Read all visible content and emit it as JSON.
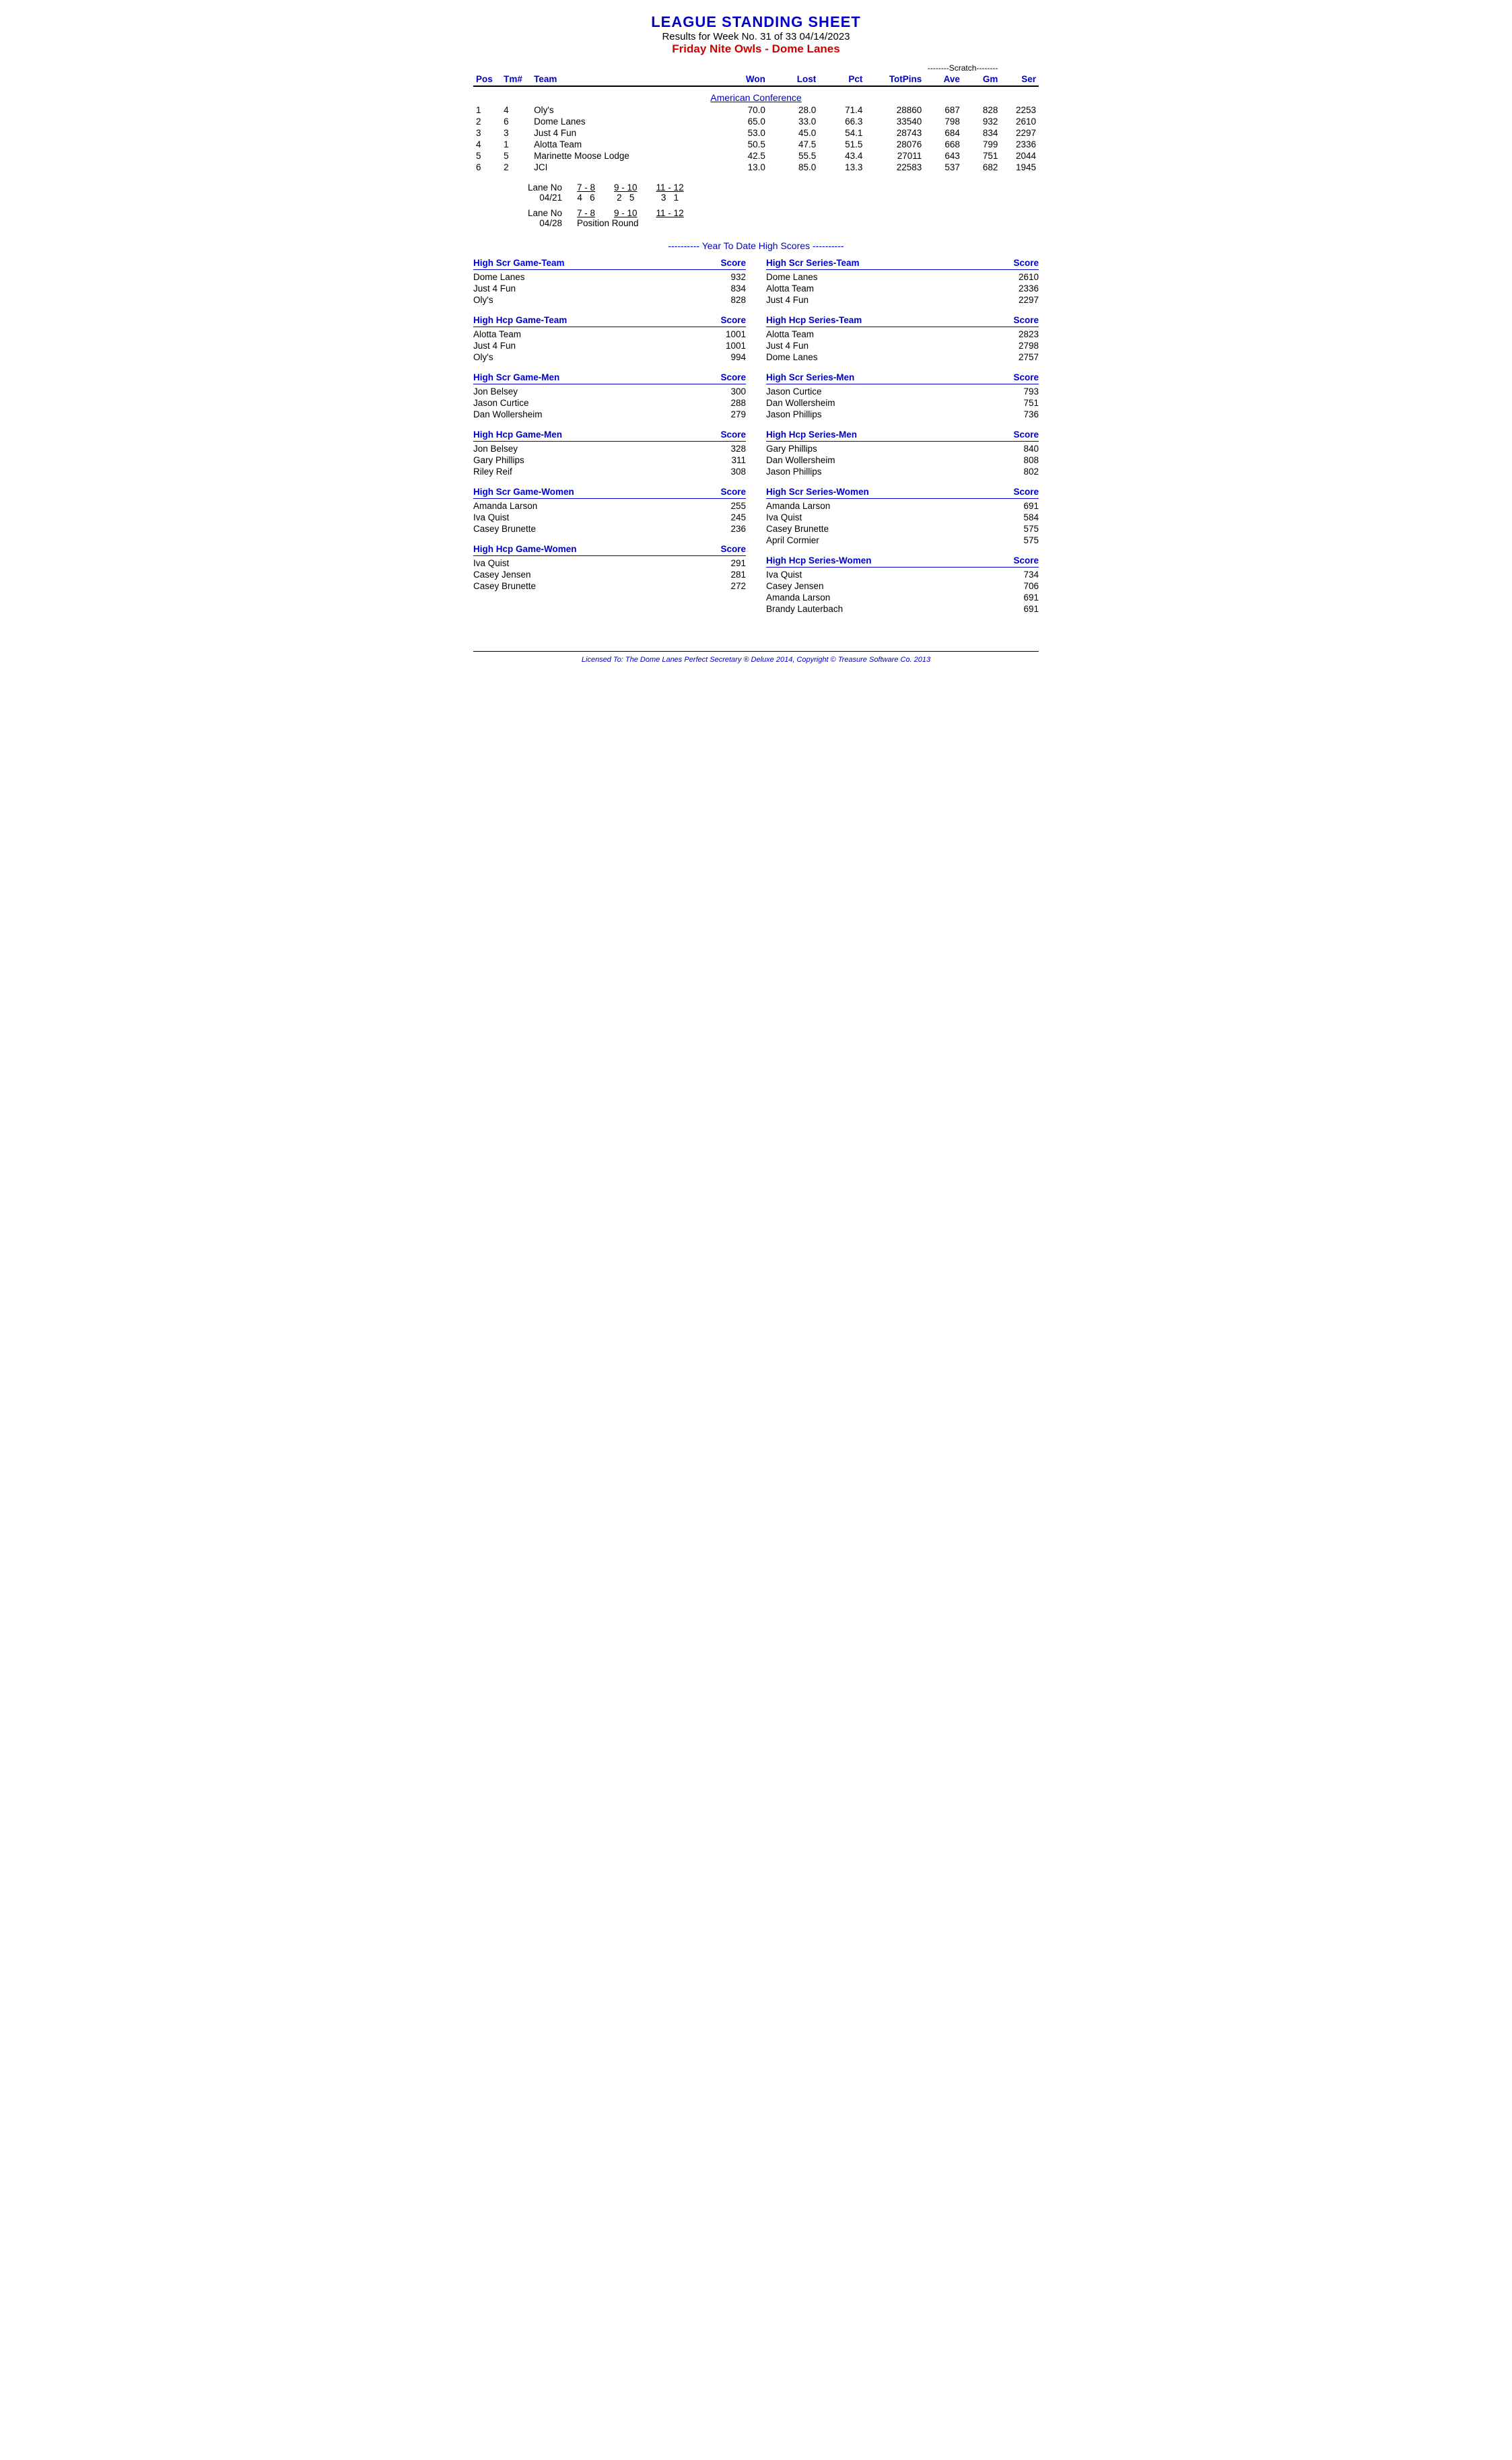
{
  "header": {
    "title": "LEAGUE STANDING SHEET",
    "subtitle": "Results for Week No. 31 of 33    04/14/2023",
    "league": "Friday Nite Owls - Dome Lanes"
  },
  "table": {
    "scratch_label": "--------Scratch--------",
    "columns": {
      "pos": "Pos",
      "tm": "Tm#",
      "team": "Team",
      "won": "Won",
      "lost": "Lost",
      "pct": "Pct",
      "totpins": "TotPins",
      "ave": "Ave",
      "gm": "Gm",
      "ser": "Ser"
    },
    "conference": "American Conference",
    "teams": [
      {
        "pos": "1",
        "tm": "4",
        "team": "Oly's",
        "won": "70.0",
        "lost": "28.0",
        "pct": "71.4",
        "totpins": "28860",
        "ave": "687",
        "gm": "828",
        "ser": "2253"
      },
      {
        "pos": "2",
        "tm": "6",
        "team": "Dome Lanes",
        "won": "65.0",
        "lost": "33.0",
        "pct": "66.3",
        "totpins": "33540",
        "ave": "798",
        "gm": "932",
        "ser": "2610"
      },
      {
        "pos": "3",
        "tm": "3",
        "team": "Just 4 Fun",
        "won": "53.0",
        "lost": "45.0",
        "pct": "54.1",
        "totpins": "28743",
        "ave": "684",
        "gm": "834",
        "ser": "2297"
      },
      {
        "pos": "4",
        "tm": "1",
        "team": "Alotta Team",
        "won": "50.5",
        "lost": "47.5",
        "pct": "51.5",
        "totpins": "28076",
        "ave": "668",
        "gm": "799",
        "ser": "2336"
      },
      {
        "pos": "5",
        "tm": "5",
        "team": "Marinette Moose Lodge",
        "won": "42.5",
        "lost": "55.5",
        "pct": "43.4",
        "totpins": "27011",
        "ave": "643",
        "gm": "751",
        "ser": "2044"
      },
      {
        "pos": "6",
        "tm": "2",
        "team": "JCI",
        "won": "13.0",
        "lost": "85.0",
        "pct": "13.3",
        "totpins": "22583",
        "ave": "537",
        "gm": "682",
        "ser": "1945"
      }
    ]
  },
  "lanes": {
    "block1_label": "Lane No",
    "block1_date": "04/21",
    "block1_groups": [
      {
        "range": "7 - 8",
        "vals": "4   6"
      },
      {
        "range": "9 - 10",
        "vals": "2   5"
      },
      {
        "range": "11 - 12",
        "vals": "3   1"
      }
    ],
    "block2_label": "Lane No",
    "block2_date": "04/28",
    "block2_groups": [
      {
        "range": "7 - 8",
        "vals": ""
      },
      {
        "range": "9 - 10",
        "vals": ""
      },
      {
        "range": "11 - 12",
        "vals": ""
      }
    ],
    "block2_note": "Position Round"
  },
  "ytd": {
    "label": "---------- Year To Date High Scores ----------"
  },
  "high_scores": {
    "left": [
      {
        "category": "High Scr Game-Team",
        "score_label": "Score",
        "entries": [
          {
            "name": "Dome Lanes",
            "score": "932"
          },
          {
            "name": "Just 4 Fun",
            "score": "834"
          },
          {
            "name": "Oly's",
            "score": "828"
          }
        ]
      },
      {
        "category": "High Hcp Game-Team",
        "score_label": "Score",
        "entries": [
          {
            "name": "Alotta Team",
            "score": "1001"
          },
          {
            "name": "Just 4 Fun",
            "score": "1001"
          },
          {
            "name": "Oly's",
            "score": "994"
          }
        ]
      },
      {
        "category": "High Scr Game-Men",
        "score_label": "Score",
        "entries": [
          {
            "name": "Jon Belsey",
            "score": "300"
          },
          {
            "name": "Jason Curtice",
            "score": "288"
          },
          {
            "name": "Dan Wollersheim",
            "score": "279"
          }
        ]
      },
      {
        "category": "High Hcp Game-Men",
        "score_label": "Score",
        "entries": [
          {
            "name": "Jon Belsey",
            "score": "328"
          },
          {
            "name": "Gary Phillips",
            "score": "311"
          },
          {
            "name": "Riley Reif",
            "score": "308"
          }
        ]
      },
      {
        "category": "High Scr Game-Women",
        "score_label": "Score",
        "entries": [
          {
            "name": "Amanda Larson",
            "score": "255"
          },
          {
            "name": "Iva Quist",
            "score": "245"
          },
          {
            "name": "Casey Brunette",
            "score": "236"
          }
        ]
      },
      {
        "category": "High Hcp Game-Women",
        "score_label": "Score",
        "entries": [
          {
            "name": "Iva Quist",
            "score": "291"
          },
          {
            "name": "Casey Jensen",
            "score": "281"
          },
          {
            "name": "Casey Brunette",
            "score": "272"
          }
        ]
      }
    ],
    "right": [
      {
        "category": "High Scr Series-Team",
        "score_label": "Score",
        "entries": [
          {
            "name": "Dome Lanes",
            "score": "2610"
          },
          {
            "name": "Alotta Team",
            "score": "2336"
          },
          {
            "name": "Just 4 Fun",
            "score": "2297"
          }
        ]
      },
      {
        "category": "High Hcp Series-Team",
        "score_label": "Score",
        "entries": [
          {
            "name": "Alotta Team",
            "score": "2823"
          },
          {
            "name": "Just 4 Fun",
            "score": "2798"
          },
          {
            "name": "Dome Lanes",
            "score": "2757"
          }
        ]
      },
      {
        "category": "High Scr Series-Men",
        "score_label": "Score",
        "entries": [
          {
            "name": "Jason Curtice",
            "score": "793"
          },
          {
            "name": "Dan Wollersheim",
            "score": "751"
          },
          {
            "name": "Jason Phillips",
            "score": "736"
          }
        ]
      },
      {
        "category": "High Hcp Series-Men",
        "score_label": "Score",
        "entries": [
          {
            "name": "Gary Phillips",
            "score": "840"
          },
          {
            "name": "Dan Wollersheim",
            "score": "808"
          },
          {
            "name": "Jason Phillips",
            "score": "802"
          }
        ]
      },
      {
        "category": "High Scr Series-Women",
        "score_label": "Score",
        "entries": [
          {
            "name": "Amanda Larson",
            "score": "691"
          },
          {
            "name": "Iva Quist",
            "score": "584"
          },
          {
            "name": "Casey Brunette",
            "score": "575"
          },
          {
            "name": "April Cormier",
            "score": "575"
          }
        ]
      },
      {
        "category": "High Hcp Series-Women",
        "score_label": "Score",
        "entries": [
          {
            "name": "Iva Quist",
            "score": "734"
          },
          {
            "name": "Casey Jensen",
            "score": "706"
          },
          {
            "name": "Amanda Larson",
            "score": "691"
          },
          {
            "name": "Brandy Lauterbach",
            "score": "691"
          }
        ]
      }
    ]
  },
  "footer": {
    "text": "Licensed To:  The Dome Lanes     Perfect Secretary ® Deluxe  2014, Copyright © Treasure Software Co. 2013"
  }
}
